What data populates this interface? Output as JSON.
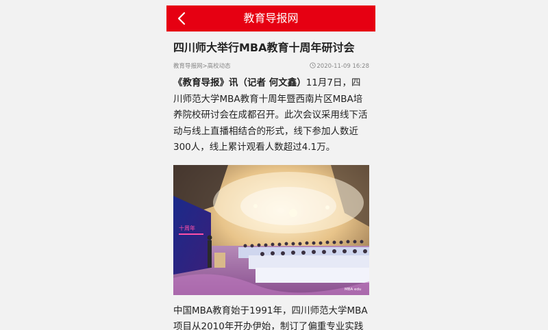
{
  "header": {
    "title": "教育导报网",
    "bg_color": "#e60012",
    "back_icon": "chevron-left-icon"
  },
  "article": {
    "title": "四川师大举行MBA教育十周年研讨会",
    "breadcrumb": "教育导报网>高校动态",
    "date": "2020-11-09 16:28",
    "lead": "《教育导报》讯（记者 何文鑫）",
    "para1_rest": "11月7日，四川师范大学MBA教育十周年暨西南片区MBA培养院校研讨会在成都召开。此次会议采用线下活动与线上直播相结合的形式，线下参加人数近300人，线上累计观看人数超过4.1万。",
    "image_watermark": "MBA edu",
    "para2": "中国MBA教育始于1991年，四川师范大学MBA项目从2010年开办伊始，制订了偏重专业实践"
  }
}
